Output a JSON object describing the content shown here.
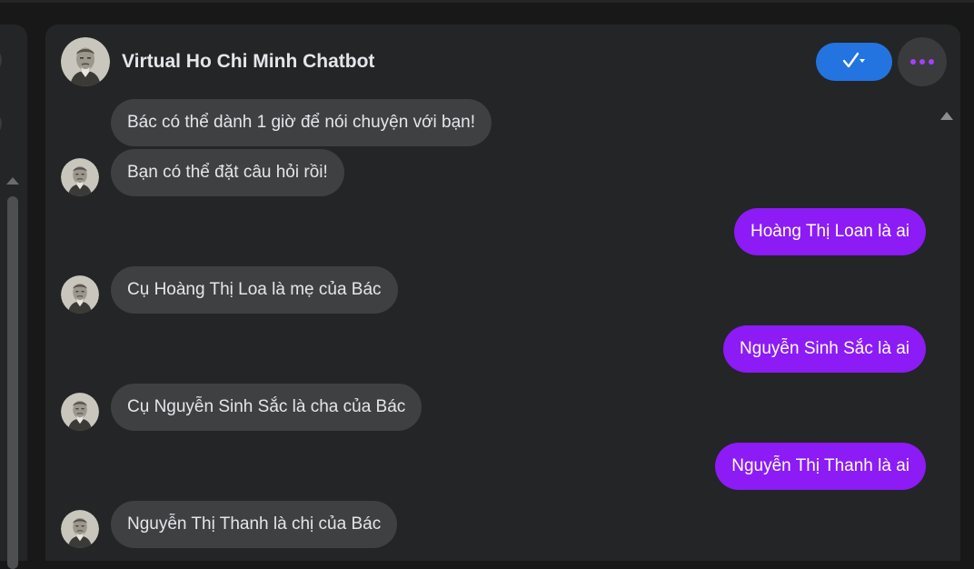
{
  "chat": {
    "title": "Virtual Ho Chi Minh Chatbot",
    "check_icon": "check-dropdown-icon",
    "more_icon": "more-dots-icon"
  },
  "colors": {
    "accent": "#2374e1",
    "user_bubble": "#8c1bf6",
    "bot_bubble": "#3e4042",
    "background": "#242526"
  },
  "messages": [
    {
      "sender": "bot",
      "text": "Bác có thể dành 1 giờ để nói chuyện với bạn!"
    },
    {
      "sender": "bot",
      "text": "Bạn có thể đặt câu hỏi rồi!"
    },
    {
      "sender": "user",
      "text": "Hoàng Thị Loan là ai"
    },
    {
      "sender": "bot",
      "text": "Cụ Hoàng Thị Loa là mẹ của Bác"
    },
    {
      "sender": "user",
      "text": "Nguyễn Sinh Sắc là ai"
    },
    {
      "sender": "bot",
      "text": "Cụ Nguyễn Sinh Sắc là cha của Bác"
    },
    {
      "sender": "user",
      "text": "Nguyễn Thị Thanh là ai"
    },
    {
      "sender": "bot",
      "text": "Nguyễn Thị Thanh là chị của Bác"
    }
  ]
}
